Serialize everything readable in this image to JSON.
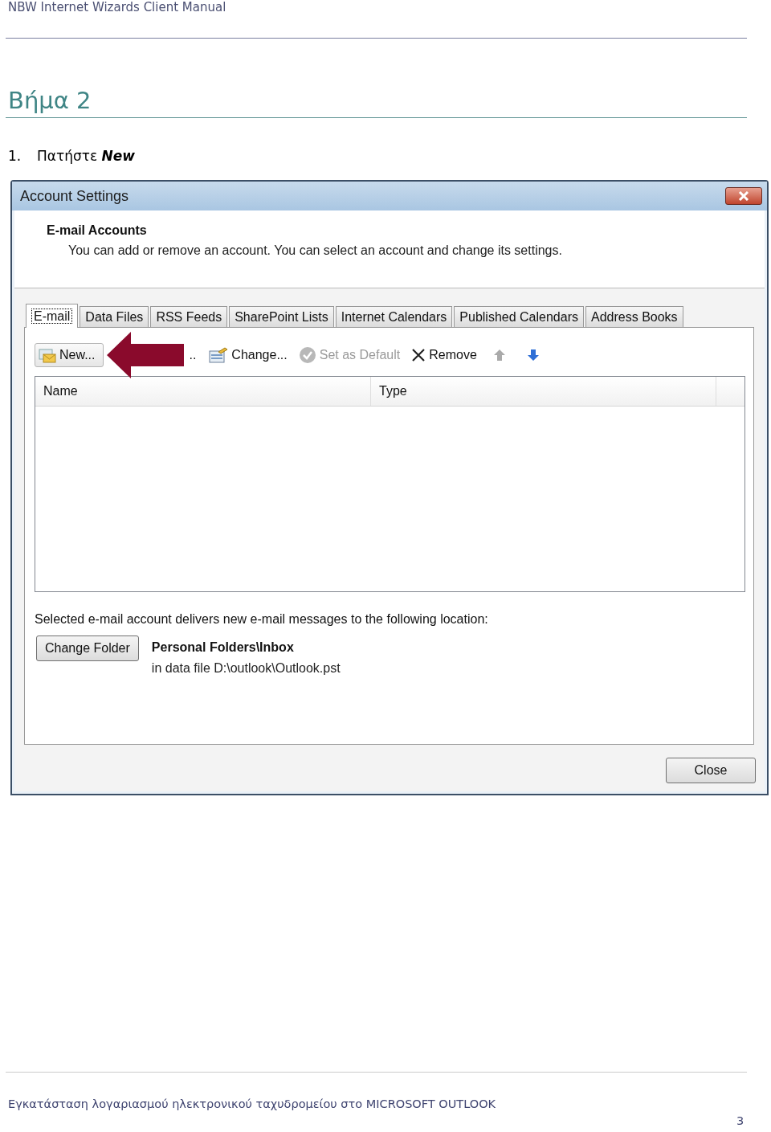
{
  "header": {
    "title": "NBW Internet Wizards Client Manual"
  },
  "heading": "Βήμα 2",
  "steps": [
    {
      "number": "1.",
      "text": "Πατήστε **New**"
    }
  ],
  "dialog": {
    "title": "Account Settings",
    "section_title": "E-mail Accounts",
    "section_description": "You can add or remove an account. You can select an account and change its settings.",
    "tabs": [
      {
        "label": "E-mail",
        "selected": true
      },
      {
        "label": "Data Files",
        "selected": false
      },
      {
        "label": "RSS Feeds",
        "selected": false
      },
      {
        "label": "SharePoint Lists",
        "selected": false
      },
      {
        "label": "Internet Calendars",
        "selected": false
      },
      {
        "label": "Published Calendars",
        "selected": false
      },
      {
        "label": "Address Books",
        "selected": false
      }
    ],
    "toolbar": [
      {
        "kind": "new",
        "label": "New...",
        "disabled": false
      },
      {
        "kind": "partial",
        "label": "..",
        "disabled": false
      },
      {
        "kind": "change",
        "label": "Change...",
        "disabled": false
      },
      {
        "kind": "default",
        "label": "Set as Default",
        "disabled": true
      },
      {
        "kind": "remove",
        "label": "Remove",
        "disabled": false
      },
      {
        "kind": "up",
        "disabled": true
      },
      {
        "kind": "down",
        "disabled": false
      }
    ],
    "table": {
      "columns": [
        "Name",
        "Type"
      ]
    },
    "delivery_text": "Selected e-mail account delivers new e-mail messages to the following location:",
    "change_folder_button": "Change Folder",
    "location": "Personal Folders\\Inbox",
    "data_file": "in data file D:\\outlook\\Outlook.pst",
    "close_button": "Close"
  },
  "footer": {
    "text": "Εγκατάσταση λογαριασμού ηλεκτρονικού ταχυδρομείου στο MICROSOFT OUTLOOK",
    "page_number": "3"
  }
}
